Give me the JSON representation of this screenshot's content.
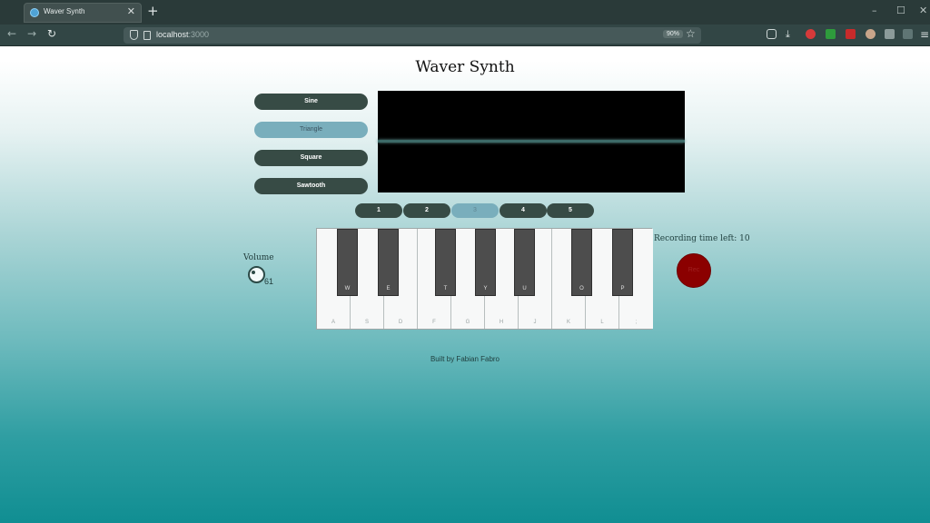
{
  "browser": {
    "tab_title": "Waver Synth",
    "tab_close": "✕",
    "new_tab": "+",
    "url_host": "localhost",
    "url_port": ":3000",
    "zoom": "90%",
    "window_controls": [
      "–",
      "☐",
      "✕"
    ]
  },
  "app": {
    "title": "Waver Synth",
    "waveforms": [
      {
        "label": "Sine",
        "active": false
      },
      {
        "label": "Triangle",
        "active": true
      },
      {
        "label": "Square",
        "active": false
      },
      {
        "label": "Sawtooth",
        "active": false
      }
    ],
    "octaves": [
      {
        "label": "1",
        "active": false
      },
      {
        "label": "2",
        "active": false
      },
      {
        "label": "3",
        "active": true
      },
      {
        "label": "4",
        "active": false
      },
      {
        "label": "5",
        "active": false
      }
    ],
    "volume": {
      "label": "Volume",
      "value": "61"
    },
    "keyboard": {
      "white_keys": [
        "A",
        "S",
        "D",
        "F",
        "G",
        "H",
        "J",
        "K",
        "L",
        ";"
      ],
      "black_keys": [
        "W",
        "E",
        "T",
        "Y",
        "U",
        "O",
        "P"
      ]
    },
    "recording": {
      "label": "Recording time left: 10",
      "button": "Rec"
    },
    "footer": "Built by Fabian Fabro"
  },
  "colors": {
    "button": "#374b45",
    "button_active": "#79aebc",
    "record": "#8b0000",
    "scope_bg": "#000000"
  }
}
